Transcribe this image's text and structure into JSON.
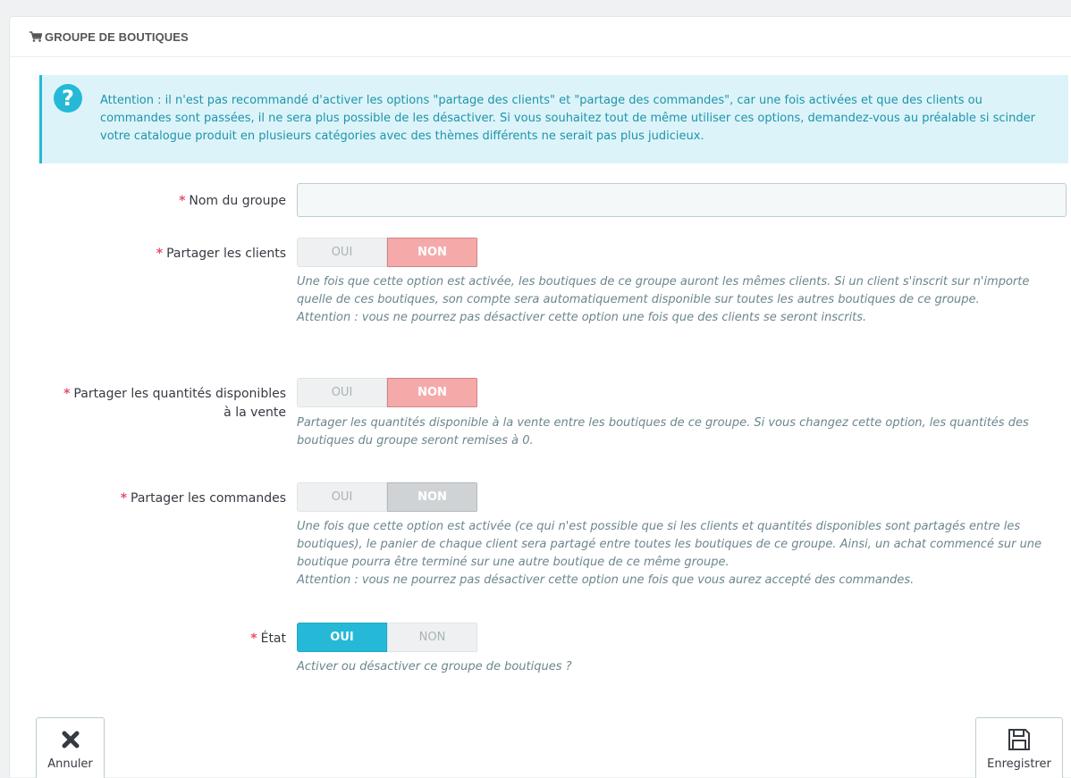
{
  "heading": {
    "title": "GROUPE DE BOUTIQUES",
    "icon": "shopping-cart-icon"
  },
  "alert": {
    "icon": "question-icon",
    "text": "Attention : il n'est pas recommandé d'activer les options \"partage des clients\" et \"partage des commandes\", car une fois activées et que des clients ou commandes sont passées, il ne sera plus possible de les désactiver. Si vous souhaitez tout de même utiliser ces options, demandez-vous au préalable si scinder votre catalogue produit en plusieurs catégories avec des thèmes différents ne serait pas plus judicieux."
  },
  "form": {
    "required_marker": "*",
    "group_name": {
      "label": "Nom du groupe",
      "value": ""
    },
    "share_customers": {
      "label": "Partager les clients",
      "yes": "OUI",
      "no": "NON",
      "selected": "NON",
      "help_1": "Une fois que cette option est activée, les boutiques de ce groupe auront les mêmes clients. Si un client s'inscrit sur n'importe quelle de ces boutiques, son compte sera automatiquement disponible sur toutes les autres boutiques de ce groupe.",
      "help_2": "Attention : vous ne pourrez pas désactiver cette option une fois que des clients se seront inscrits."
    },
    "share_stock": {
      "label_line1": "Partager les quantités disponibles",
      "label_line2": "à la vente",
      "yes": "OUI",
      "no": "NON",
      "selected": "NON",
      "help_1": "Partager les quantités disponible à la vente entre les boutiques de ce groupe. Si vous changez cette option, les quantités des boutiques du groupe seront remises à 0."
    },
    "share_orders": {
      "label": "Partager les commandes",
      "yes": "OUI",
      "no": "NON",
      "selected": "NON",
      "disabled": true,
      "help_1": "Une fois que cette option est activée (ce qui n'est possible que si les clients et quantités disponibles sont partagés entre les boutiques), le panier de chaque client sera partagé entre toutes les boutiques de ce groupe. Ainsi, un achat commencé sur une boutique pourra être terminé sur une autre boutique de ce même groupe.",
      "help_2": "Attention : vous ne pourrez pas désactiver cette option une fois que vous aurez accepté des commandes."
    },
    "status": {
      "label": "État",
      "yes": "OUI",
      "no": "NON",
      "selected": "OUI",
      "help_1": "Activer ou désactiver ce groupe de boutiques ?"
    }
  },
  "footer": {
    "cancel": {
      "label": "Annuler",
      "icon": "close-icon"
    },
    "save": {
      "label": "Enregistrer",
      "icon": "save-icon"
    }
  },
  "colors": {
    "accent": "#25b9d7",
    "alert_bg": "#dcf4f9",
    "required": "#e84e6a",
    "toggle_no": "#f5aaa9",
    "toggle_disabled": "#d0d3d5"
  }
}
